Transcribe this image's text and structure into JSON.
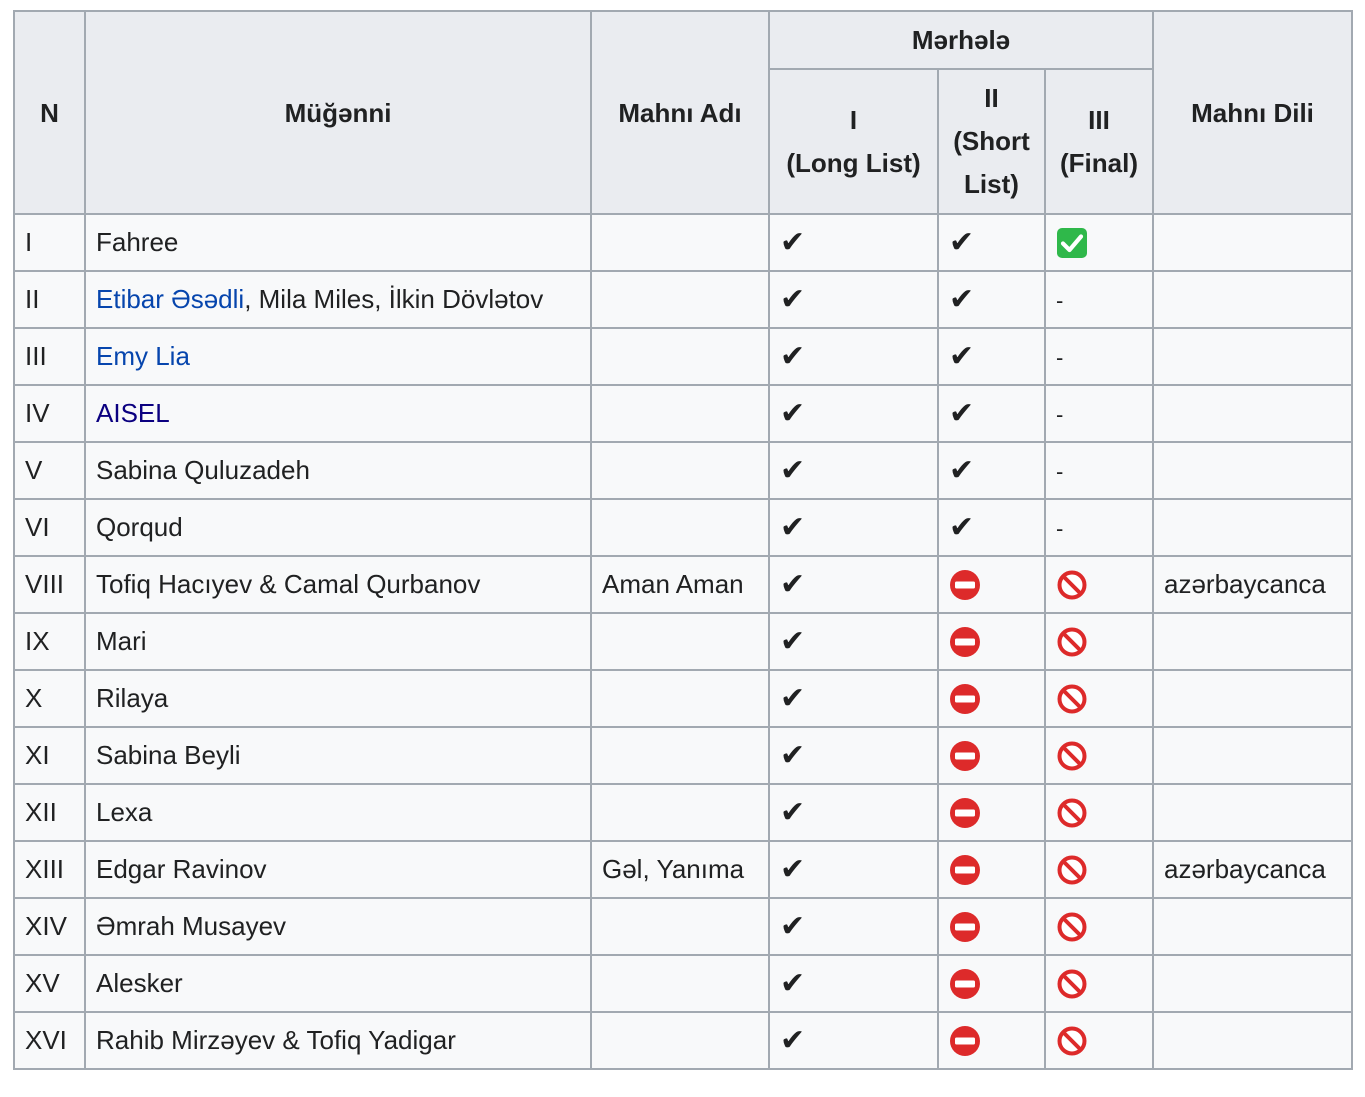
{
  "headers": {
    "n": "N",
    "singer": "Müğənni",
    "song": "Mahnı Adı",
    "stage": "Mərhələ",
    "stage1_roman": "I",
    "stage1_name": "(Long List)",
    "stage2_roman": "II",
    "stage2_name_a": "(Short",
    "stage2_name_b": "List)",
    "stage3_roman": "III",
    "stage3_name": "(Final)",
    "language": "Mahnı Dili"
  },
  "symbols": {
    "check": "✔",
    "dash": "-",
    "final_icon": "green-check-box-icon",
    "eliminated_icon": "no-entry-icon",
    "not_passed_icon": "prohibited-icon"
  },
  "colors": {
    "link": "#0645ad",
    "link_visited": "#0b0080",
    "green_box": "#2fb84a",
    "red_icon": "#dd2a2a"
  },
  "rows": [
    {
      "n": "I",
      "singer": [
        {
          "text": "Fahree",
          "link": false
        }
      ],
      "song": "",
      "s1": "check",
      "s2": "check",
      "s3": "final",
      "lang": ""
    },
    {
      "n": "II",
      "singer": [
        {
          "text": "Etibar Əsədli",
          "link": true
        },
        {
          "text": ", Mila Miles, İlkin Dövlətov",
          "link": false
        }
      ],
      "song": "",
      "s1": "check",
      "s2": "check",
      "s3": "dash",
      "lang": ""
    },
    {
      "n": "III",
      "singer": [
        {
          "text": "Emy Lia",
          "link": true
        }
      ],
      "song": "",
      "s1": "check",
      "s2": "check",
      "s3": "dash",
      "lang": ""
    },
    {
      "n": "IV",
      "singer": [
        {
          "text": "AISEL",
          "link": "visited"
        }
      ],
      "song": "",
      "s1": "check",
      "s2": "check",
      "s3": "dash",
      "lang": ""
    },
    {
      "n": "V",
      "singer": [
        {
          "text": "Sabina Quluzadeh",
          "link": false
        }
      ],
      "song": "",
      "s1": "check",
      "s2": "check",
      "s3": "dash",
      "lang": ""
    },
    {
      "n": "VI",
      "singer": [
        {
          "text": "Qorqud",
          "link": false
        }
      ],
      "song": "",
      "s1": "check",
      "s2": "check",
      "s3": "dash",
      "lang": ""
    },
    {
      "n": "VIII",
      "singer": [
        {
          "text": "Tofiq Hacıyev & Camal Qurbanov",
          "link": false
        }
      ],
      "song": "Aman Aman",
      "s1": "check",
      "s2": "noentry",
      "s3": "prohibited",
      "lang": "azərbaycanca"
    },
    {
      "n": "IX",
      "singer": [
        {
          "text": "Mari",
          "link": false
        }
      ],
      "song": "",
      "s1": "check",
      "s2": "noentry",
      "s3": "prohibited",
      "lang": ""
    },
    {
      "n": "X",
      "singer": [
        {
          "text": "Rilaya",
          "link": false
        }
      ],
      "song": "",
      "s1": "check",
      "s2": "noentry",
      "s3": "prohibited",
      "lang": ""
    },
    {
      "n": "XI",
      "singer": [
        {
          "text": "Sabina Beyli",
          "link": false
        }
      ],
      "song": "",
      "s1": "check",
      "s2": "noentry",
      "s3": "prohibited",
      "lang": ""
    },
    {
      "n": "XII",
      "singer": [
        {
          "text": "Lexa",
          "link": false
        }
      ],
      "song": "",
      "s1": "check",
      "s2": "noentry",
      "s3": "prohibited",
      "lang": ""
    },
    {
      "n": "XIII",
      "singer": [
        {
          "text": "Edgar Ravinov",
          "link": false
        }
      ],
      "song": "Gəl, Yanıma",
      "s1": "check",
      "s2": "noentry",
      "s3": "prohibited",
      "lang": "azərbaycanca"
    },
    {
      "n": "XIV",
      "singer": [
        {
          "text": "Əmrah Musayev",
          "link": false
        }
      ],
      "song": "",
      "s1": "check",
      "s2": "noentry",
      "s3": "prohibited",
      "lang": ""
    },
    {
      "n": "XV",
      "singer": [
        {
          "text": "Alesker",
          "link": false
        }
      ],
      "song": "",
      "s1": "check",
      "s2": "noentry",
      "s3": "prohibited",
      "lang": ""
    },
    {
      "n": "XVI",
      "singer": [
        {
          "text": "Rahib Mirzəyev & Tofiq Yadigar",
          "link": false
        }
      ],
      "song": "",
      "s1": "check",
      "s2": "noentry",
      "s3": "prohibited",
      "lang": ""
    }
  ]
}
